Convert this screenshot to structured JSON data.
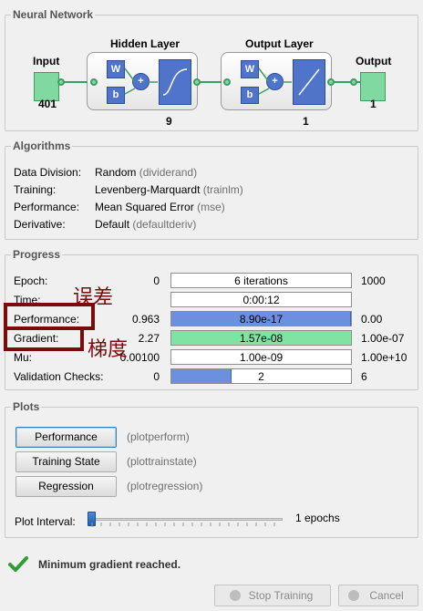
{
  "network": {
    "title": "Neural Network",
    "input": {
      "label": "Input",
      "size": "401"
    },
    "hidden_layer": {
      "label": "Hidden Layer",
      "size": "9",
      "w": "W",
      "b": "b",
      "plus": "+"
    },
    "output_layer": {
      "label": "Output Layer",
      "size": "1",
      "w": "W",
      "b": "b",
      "plus": "+"
    },
    "output": {
      "label": "Output",
      "size": "1"
    }
  },
  "algorithms": {
    "title": "Algorithms",
    "rows": [
      {
        "label": "Data Division:",
        "value": "Random",
        "code": "(dividerand)"
      },
      {
        "label": "Training:",
        "value": "Levenberg-Marquardt",
        "code": "(trainlm)"
      },
      {
        "label": "Performance:",
        "value": "Mean Squared Error",
        "code": "(mse)"
      },
      {
        "label": "Derivative:",
        "value": "Default",
        "code": "(defaultderiv)"
      }
    ]
  },
  "progress": {
    "title": "Progress",
    "rows": [
      {
        "label": "Epoch:",
        "start": "0",
        "text": "6 iterations",
        "end": "1000",
        "fill": 0.0,
        "color": "blue"
      },
      {
        "label": "Time:",
        "start": "",
        "text": "0:00:12",
        "end": "",
        "fill": 0.0,
        "color": "blue"
      },
      {
        "label": "Performance:",
        "start": "0.963",
        "text": "8.90e-17",
        "end": "0.00",
        "fill": 1.0,
        "color": "blue"
      },
      {
        "label": "Gradient:",
        "start": "2.27",
        "text": "1.57e-08",
        "end": "1.00e-07",
        "fill": 1.0,
        "color": "green"
      },
      {
        "label": "Mu:",
        "start": "0.00100",
        "text": "1.00e-09",
        "end": "1.00e+10",
        "fill": 0.0,
        "color": "blue"
      },
      {
        "label": "Validation Checks:",
        "start": "0",
        "text": "2",
        "end": "6",
        "fill": 0.333,
        "color": "blue"
      }
    ]
  },
  "plots": {
    "title": "Plots",
    "buttons": [
      {
        "label": "Performance",
        "code": "(plotperform)"
      },
      {
        "label": "Training State",
        "code": "(plottrainstate)"
      },
      {
        "label": "Regression",
        "code": "(plotregression)"
      }
    ],
    "interval_label": "Plot Interval:",
    "interval_value": "1 epochs"
  },
  "status": {
    "message": "Minimum gradient reached."
  },
  "footer": {
    "stop_label": "Stop Training",
    "cancel_label": "Cancel"
  },
  "annotations": {
    "error_text": "误差",
    "gradient_text": "梯度"
  },
  "colors": {
    "bar_blue": "#6d8fe0",
    "bar_green": "#7fe3a4",
    "annotation": "#7a0b0b"
  }
}
